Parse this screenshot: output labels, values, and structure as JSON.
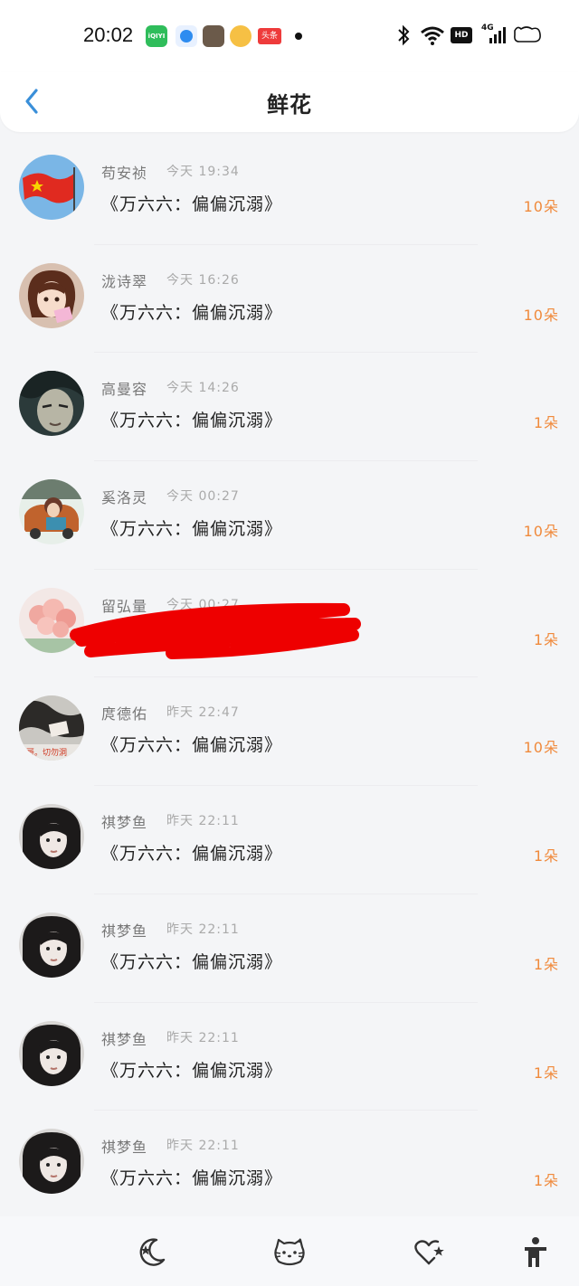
{
  "status_bar": {
    "time": "20:02",
    "notif_iqiyi": "iQIYI",
    "notif_toutiao": "头条",
    "network": "4G"
  },
  "header": {
    "title": "鲜花"
  },
  "entries": [
    {
      "name": "苟安祯",
      "time": "今天 19:34",
      "book": "《万六六：偏偏沉溺》",
      "count": "10朵",
      "avatar": "flag-avatar"
    },
    {
      "name": "泷诗翠",
      "time": "今天 16:26",
      "book": "《万六六：偏偏沉溺》",
      "count": "10朵",
      "avatar": "anime-girl-avatar"
    },
    {
      "name": "高曼容",
      "time": "今天 14:26",
      "book": "《万六六：偏偏沉溺》",
      "count": "1朵",
      "avatar": "anime-face-avatar"
    },
    {
      "name": "奚洛灵",
      "time": "今天 00:27",
      "book": "《万六六：偏偏沉溺》",
      "count": "10朵",
      "avatar": "car-avatar"
    },
    {
      "name": "留弘量",
      "time": "今天 00:27",
      "book": "",
      "count": "1朵",
      "avatar": "flowers-avatar"
    },
    {
      "name": "庹德佑",
      "time": "昨天 22:47",
      "book": "《万六六：偏偏沉溺》",
      "count": "10朵",
      "avatar": "photo-avatar"
    },
    {
      "name": "祺梦鱼",
      "time": "昨天 22:11",
      "book": "《万六六：偏偏沉溺》",
      "count": "1朵",
      "avatar": "girl-photo-avatar"
    },
    {
      "name": "祺梦鱼",
      "time": "昨天 22:11",
      "book": "《万六六：偏偏沉溺》",
      "count": "1朵",
      "avatar": "girl-photo-avatar"
    },
    {
      "name": "祺梦鱼",
      "time": "昨天 22:11",
      "book": "《万六六：偏偏沉溺》",
      "count": "1朵",
      "avatar": "girl-photo-avatar"
    },
    {
      "name": "祺梦鱼",
      "time": "昨天 22:11",
      "book": "《万六六：偏偏沉溺》",
      "count": "1朵",
      "avatar": "girl-photo-avatar"
    }
  ],
  "bottom_nav": {
    "items": [
      "moon-star-icon",
      "hello-kitty-icon",
      "heart-star-icon",
      "accessibility-icon"
    ]
  },
  "colors": {
    "accent": "#3a8fd9",
    "count": "#f08a3c"
  }
}
